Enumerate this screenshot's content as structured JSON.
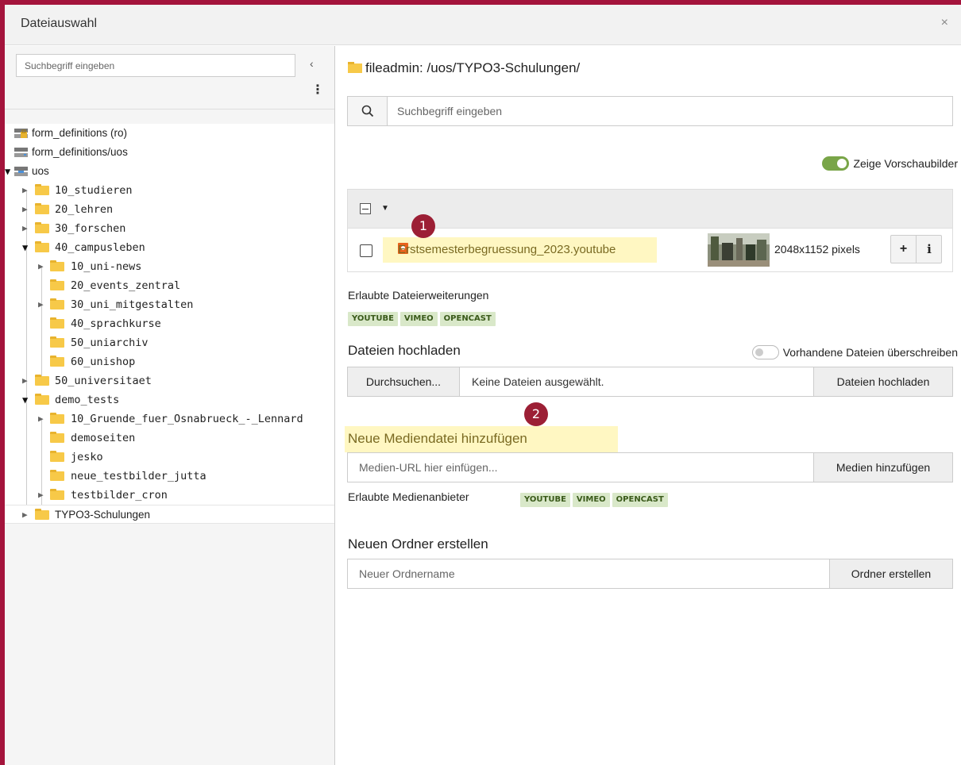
{
  "dialog": {
    "title": "Dateiauswahl",
    "close_label": "×"
  },
  "tree": {
    "search_placeholder": "Suchbegriff eingeben",
    "collapse_label": "‹",
    "menu_label": "⋮",
    "items": [
      {
        "label": "form_definitions (ro)",
        "type": "storage-locked"
      },
      {
        "label": "form_definitions/uos",
        "type": "storage"
      },
      {
        "label": "uos",
        "type": "storage",
        "expanded": true
      },
      {
        "label": "10_studieren",
        "type": "folder"
      },
      {
        "label": "20_lehren",
        "type": "folder"
      },
      {
        "label": "30_forschen",
        "type": "folder"
      },
      {
        "label": "40_campusleben",
        "type": "folder",
        "expanded": true
      },
      {
        "label": "10_uni-news",
        "type": "folder"
      },
      {
        "label": "20_events_zentral",
        "type": "folder"
      },
      {
        "label": "30_uni_mitgestalten",
        "type": "folder"
      },
      {
        "label": "40_sprachkurse",
        "type": "folder"
      },
      {
        "label": "50_uniarchiv",
        "type": "folder"
      },
      {
        "label": "60_unishop",
        "type": "folder"
      },
      {
        "label": "50_universitaet",
        "type": "folder"
      },
      {
        "label": "demo_tests",
        "type": "folder",
        "expanded": true
      },
      {
        "label": "10_Gruende_fuer_Osnabrueck_-_Lennard",
        "type": "folder"
      },
      {
        "label": "demoseiten",
        "type": "folder"
      },
      {
        "label": "jesko",
        "type": "folder"
      },
      {
        "label": "neue_testbilder_jutta",
        "type": "folder"
      },
      {
        "label": "testbilder_cron",
        "type": "folder"
      },
      {
        "label": "TYPO3-Schulungen",
        "type": "folder",
        "selected": true
      }
    ]
  },
  "main": {
    "path": "fileadmin: /uos/TYPO3-Schulungen/",
    "search_placeholder": "Suchbegriff eingeben",
    "preview_toggle_label": "Zeige Vorschaubilder",
    "file": {
      "name": "Erstsemesterbegruessung_2023.youtube",
      "dimensions": "2048x1152 pixels",
      "add_label": "+",
      "info_label": "i"
    },
    "allowed_extensions_label": "Erlaubte Dateierweiterungen",
    "allowed_extensions": [
      "YOUTUBE",
      "VIMEO",
      "OPENCAST"
    ],
    "upload": {
      "title": "Dateien hochladen",
      "overwrite_label": "Vorhandene Dateien überschreiben",
      "browse_label": "Durchsuchen...",
      "no_file_label": "Keine Dateien ausgewählt.",
      "upload_button": "Dateien hochladen"
    },
    "media": {
      "title": "Neue Mediendatei hinzufügen",
      "url_placeholder": "Medien-URL hier einfügen...",
      "add_button": "Medien hinzufügen",
      "providers_label": "Erlaubte Medienanbieter",
      "providers": [
        "YOUTUBE",
        "VIMEO",
        "OPENCAST"
      ]
    },
    "new_folder": {
      "title": "Neuen Ordner erstellen",
      "placeholder": "Neuer Ordnername",
      "create_button": "Ordner erstellen"
    },
    "markers": [
      "1",
      "2"
    ]
  },
  "colors": {
    "frame": "#a4143c",
    "highlight": "#fff7c2",
    "marker": "#9c1f35",
    "toggle_on": "#79a548",
    "badge_bg": "#d9e8c9"
  }
}
